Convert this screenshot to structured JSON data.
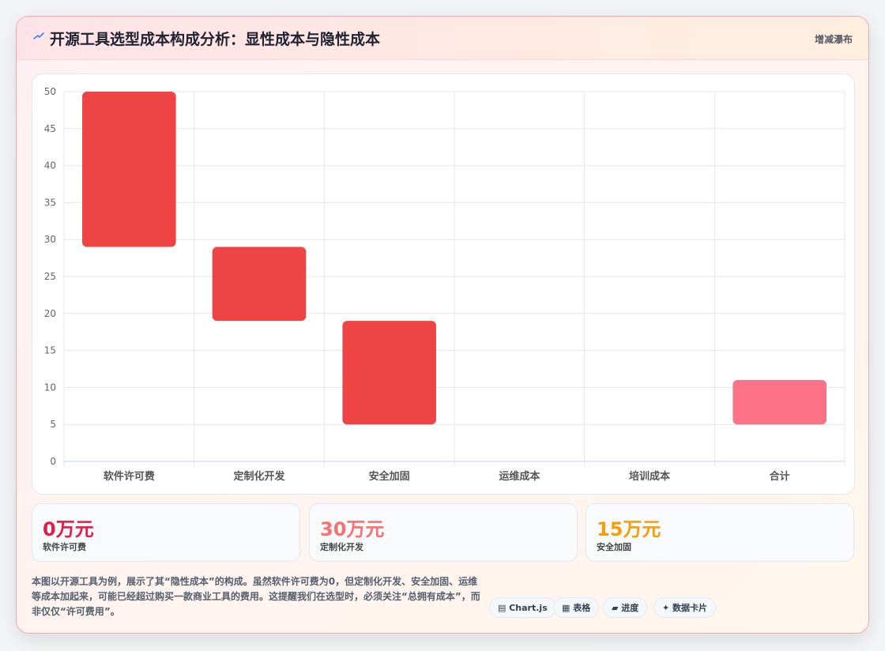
{
  "header": {
    "title": "开源工具选型成本构成分析：显性成本与隐性成本",
    "chart_type_label": "增减瀑布"
  },
  "colors": {
    "increase": "#ef4444",
    "total": "#fb7185",
    "accent_pink": "#e11d48",
    "accent_rose": "#f87171",
    "accent_orange": "#f59e0b"
  },
  "chart_data": {
    "type": "bar",
    "subtype": "waterfall",
    "categories": [
      "软件许可费",
      "定制化开发",
      "安全加固",
      "运维成本",
      "培训成本",
      "合计"
    ],
    "ranges": [
      [
        29,
        50
      ],
      [
        19,
        29
      ],
      [
        5,
        19
      ],
      [
        null,
        null
      ],
      [
        null,
        null
      ],
      [
        5,
        11
      ]
    ],
    "ylim": [
      0,
      50
    ],
    "yticks": [
      "0",
      "5",
      "10",
      "15",
      "20",
      "25",
      "30",
      "35",
      "40",
      "45",
      "50"
    ],
    "grid": true,
    "title": "",
    "xlabel": "",
    "ylabel": ""
  },
  "stats": [
    {
      "value": "0万元",
      "label": "软件许可费",
      "color": "#e11d48"
    },
    {
      "value": "30万元",
      "label": "定制化开发",
      "color": "#f87171"
    },
    {
      "value": "15万元",
      "label": "安全加固",
      "color": "#f59e0b"
    }
  ],
  "description": "本图以开源工具为例，展示了其“隐性成本”的构成。虽然软件许可费为0，但定制化开发、安全加固、运维等成本加起来，可能已经超过购买一款商业工具的费用。这提醒我们在选型时，必须关注“总拥有成本”，而非仅仅“许可费用”。",
  "tags": [
    {
      "icon": "chart-icon",
      "label": "Chart.js"
    },
    {
      "icon": "table-icon",
      "label": "表格"
    },
    {
      "icon": "progress-icon",
      "label": "进度"
    },
    {
      "icon": "card-icon",
      "label": "数据卡片"
    }
  ]
}
